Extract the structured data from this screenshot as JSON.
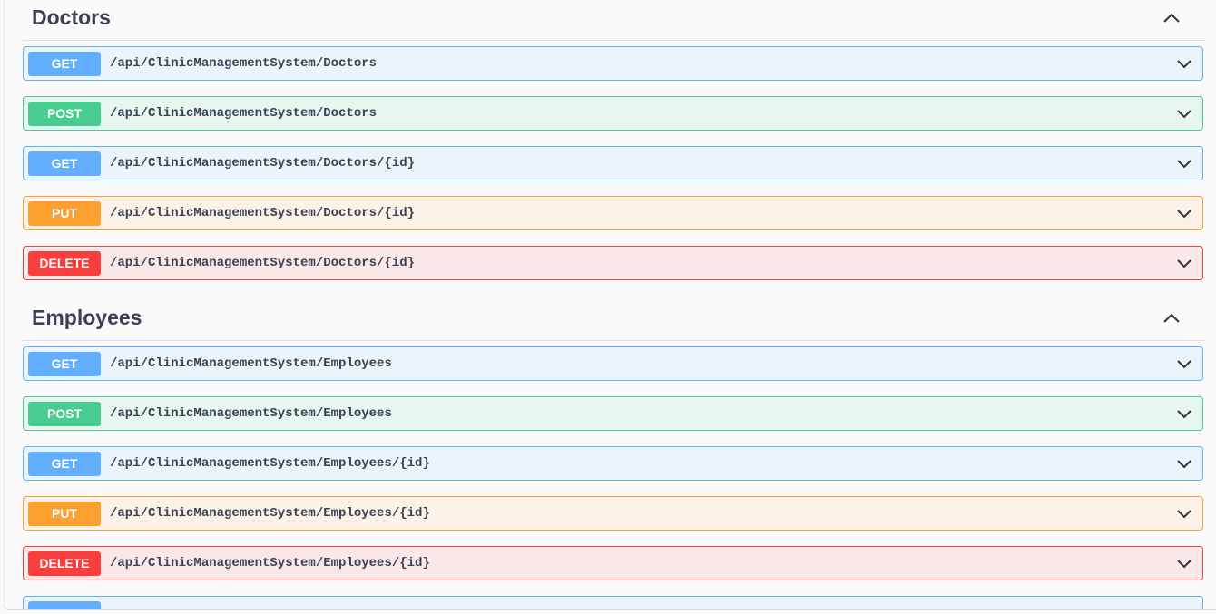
{
  "sections": [
    {
      "title": "Doctors",
      "operations": [
        {
          "method": "GET",
          "path": "/api/ClinicManagementSystem/Doctors"
        },
        {
          "method": "POST",
          "path": "/api/ClinicManagementSystem/Doctors"
        },
        {
          "method": "GET",
          "path": "/api/ClinicManagementSystem/Doctors/{id}"
        },
        {
          "method": "PUT",
          "path": "/api/ClinicManagementSystem/Doctors/{id}"
        },
        {
          "method": "DELETE",
          "path": "/api/ClinicManagementSystem/Doctors/{id}"
        }
      ]
    },
    {
      "title": "Employees",
      "operations": [
        {
          "method": "GET",
          "path": "/api/ClinicManagementSystem/Employees"
        },
        {
          "method": "POST",
          "path": "/api/ClinicManagementSystem/Employees"
        },
        {
          "method": "GET",
          "path": "/api/ClinicManagementSystem/Employees/{id}"
        },
        {
          "method": "PUT",
          "path": "/api/ClinicManagementSystem/Employees/{id}"
        },
        {
          "method": "DELETE",
          "path": "/api/ClinicManagementSystem/Employees/{id}"
        }
      ]
    }
  ],
  "icons": {
    "section_toggle": "chevron-up-icon",
    "operation_toggle": "chevron-down-icon"
  },
  "colors": {
    "get": "#61affe",
    "post": "#49cc90",
    "put": "#fca130",
    "delete": "#f93e3e",
    "text": "#3b4151"
  }
}
